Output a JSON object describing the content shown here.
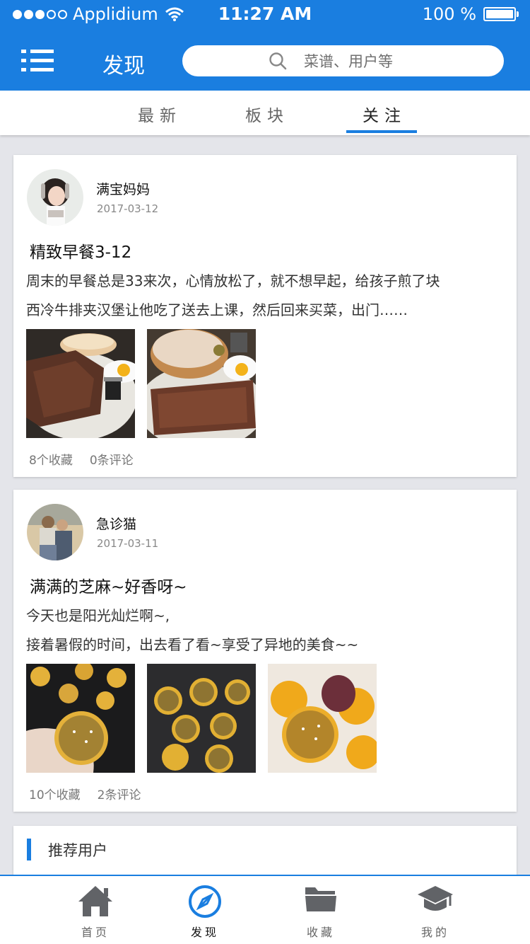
{
  "status_bar": {
    "carrier": "Applidium",
    "time": "11:27 AM",
    "battery": "100 %"
  },
  "header": {
    "title": "发现",
    "search_placeholder": "菜谱、用户等",
    "icons": {
      "menu": "menu-icon",
      "search": "search-icon"
    }
  },
  "tabs": [
    {
      "label": "最新",
      "active": false
    },
    {
      "label": "板块",
      "active": false
    },
    {
      "label": "关注",
      "active": true
    }
  ],
  "posts": [
    {
      "user": "满宝妈妈",
      "date": "2017-03-12",
      "title": "精致早餐3-12",
      "text_lines": [
        "周末的早餐总是33来次，心情放松了，就不想早起，给孩子煎了块",
        "西冷牛排夹汉堡让他吃了送去上课，然后回来买菜，出门……"
      ],
      "favorites": "8个收藏",
      "comments": "0条评论"
    },
    {
      "user": "急诊猫",
      "date": "2017-03-11",
      "title": "满满的芝麻~好香呀~",
      "text_lines": [
        "今天也是阳光灿烂啊~,",
        "接着暑假的时间，出去看了看~享受了异地的美食~~"
      ],
      "favorites": "10个收藏",
      "comments": "2条评论"
    }
  ],
  "recommend": {
    "label": "推荐用户"
  },
  "bottom_nav": [
    {
      "label": "首页",
      "icon": "home-icon",
      "active": false
    },
    {
      "label": "发现",
      "icon": "compass-icon",
      "active": true
    },
    {
      "label": "收藏",
      "icon": "folder-icon",
      "active": false
    },
    {
      "label": "我的",
      "icon": "graduation-cap-icon",
      "active": false
    }
  ],
  "colors": {
    "brand": "#1a7ee0",
    "background": "#e4e5ea",
    "icon_gray": "#616367"
  }
}
